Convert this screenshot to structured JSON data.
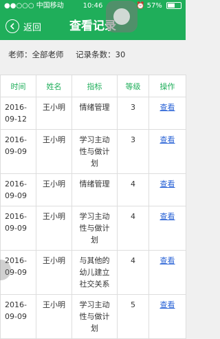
{
  "status": {
    "carrier": "●●○○○ 中国移动",
    "wifi_icon": "wifi-icon",
    "time": "10:46",
    "battery_text": "57%",
    "battery_fraction": 0.57
  },
  "nav": {
    "back_label": "返回",
    "title": "查看记录"
  },
  "info": {
    "teacher": "老师：全部老师",
    "count": "记录条数：30"
  },
  "table": {
    "headers": [
      "时间",
      "姓名",
      "指标",
      "等级",
      "操作"
    ],
    "rows": [
      {
        "date": "2016-09-12",
        "name": "王小明",
        "indicator": "情绪管理",
        "level": "3",
        "action": "查看"
      },
      {
        "date": "2016-09-09",
        "name": "王小明",
        "indicator": "学习主动性与做计划",
        "level": "3",
        "action": "查看"
      },
      {
        "date": "2016-09-09",
        "name": "王小明",
        "indicator": "情绪管理",
        "level": "4",
        "action": "查看"
      },
      {
        "date": "2016-09-09",
        "name": "王小明",
        "indicator": "学习主动性与做计划",
        "level": "4",
        "action": "查看"
      },
      {
        "date": "2016-09-09",
        "name": "王小明",
        "indicator": "与其他的幼儿建立社交关系",
        "level": "4",
        "action": "查看"
      },
      {
        "date": "2016-09-09",
        "name": "王小明",
        "indicator": "学习主动性与做计划",
        "level": "5",
        "action": "查看"
      }
    ]
  },
  "colors": {
    "primary": "#1fae5a",
    "link": "#2a63d6"
  }
}
